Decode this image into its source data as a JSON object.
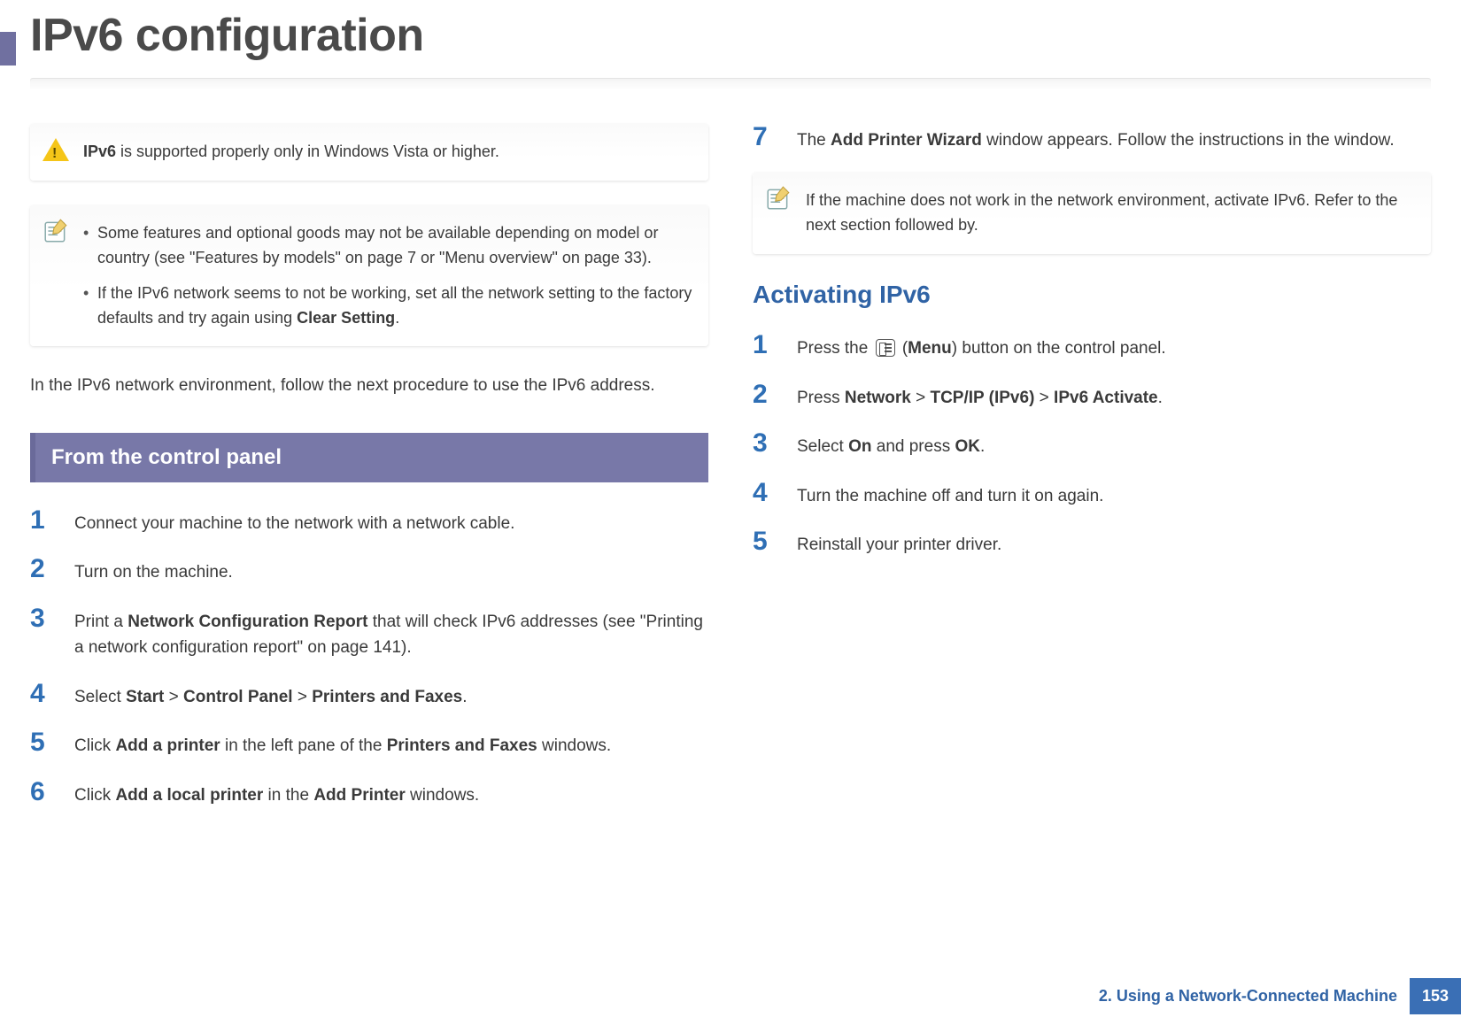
{
  "header": {
    "title": "IPv6 configuration"
  },
  "boxes": {
    "warn": {
      "text_pre": "IPv6",
      "text_post": " is supported properly only in Windows Vista or higher."
    },
    "note1": {
      "item1_a": "Some features and optional goods may not be available depending on model or country (see \"Features by models\" on page 7 ",
      "item1_or": "or",
      "item1_b": " \"Menu overview\" on page 33).",
      "item2_a": "If the IPv6 network seems to not be working, set all the network setting to the factory defaults and try again using ",
      "item2_bold": "Clear Setting",
      "item2_b": "."
    },
    "note2": {
      "text": "If the machine does not work in the network environment, activate IPv6. Refer to the next section followed by."
    }
  },
  "intro": "In the IPv6 network environment, follow the next procedure to use the IPv6 address.",
  "section_band": "From the control panel",
  "left_steps": {
    "s1": {
      "num": "1",
      "text": "Connect your machine to the network with a network cable."
    },
    "s2": {
      "num": "2",
      "text": "Turn on the machine."
    },
    "s3": {
      "num": "3",
      "a": "Print a ",
      "b1": "Network Configuration Report",
      "c": " that will check IPv6 addresses (see \"Printing a network configuration report\" on page 141)."
    },
    "s4": {
      "num": "4",
      "a": "Select ",
      "p1": "Start",
      "gt1": " > ",
      "p2": "Control Panel",
      "gt2": " > ",
      "p3": "Printers and Faxes",
      "end": "."
    },
    "s5": {
      "num": "5",
      "a": "Click ",
      "b1": "Add a printer",
      "mid": " in the left pane of the ",
      "b2": "Printers and Faxes",
      "end": " windows."
    },
    "s6": {
      "num": "6",
      "a": "Click ",
      "b1": "Add a local printer",
      "mid": " in the ",
      "b2": "Add Printer",
      "end": " windows."
    }
  },
  "right_steps_top": {
    "s7": {
      "num": "7",
      "a": "The ",
      "b1": "Add Printer Wizard",
      "end": " window appears. Follow the instructions in the window."
    }
  },
  "subsection": "Activating IPv6",
  "right_steps_bottom": {
    "s1": {
      "num": "1",
      "a": "Press the ",
      "menu": "Menu",
      "end": ") button on the control panel."
    },
    "s2": {
      "num": "2",
      "a": "Press ",
      "p1": "Network",
      "gt1": " > ",
      "p2": "TCP/IP (IPv6)",
      "gt2": " > ",
      "p3": "IPv6 Activate",
      "end": "."
    },
    "s3": {
      "num": "3",
      "a": "Select ",
      "b1": "On",
      "mid": " and press ",
      "b2": "OK",
      "end": "."
    },
    "s4": {
      "num": "4",
      "text": "Turn the machine off and turn it on again."
    },
    "s5": {
      "num": "5",
      "text": "Reinstall your printer driver."
    }
  },
  "footer": {
    "chapter": "2.  Using a Network-Connected Machine",
    "page": "153"
  }
}
